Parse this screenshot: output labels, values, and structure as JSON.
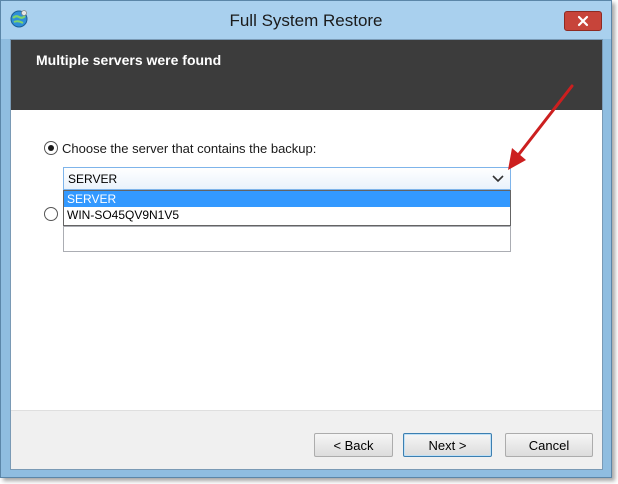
{
  "window": {
    "title": "Full System Restore",
    "icon": "backup-globe-icon",
    "close_icon": "close-icon"
  },
  "header": {
    "title": "Multiple servers were found"
  },
  "options": {
    "choose_server_label": "Choose the server that contains the backup:",
    "choose_server_selected": true,
    "second_option_selected": false
  },
  "server_combo": {
    "selected_value": "SERVER",
    "options": [
      "SERVER",
      "WIN-SO45QV9N1V5"
    ]
  },
  "buttons": {
    "back": "< Back",
    "next": "Next >",
    "cancel": "Cancel"
  },
  "colors": {
    "header_band": "#3c3c3c",
    "selection_highlight": "#3399ff",
    "annotation_arrow": "#cc1f1f"
  }
}
